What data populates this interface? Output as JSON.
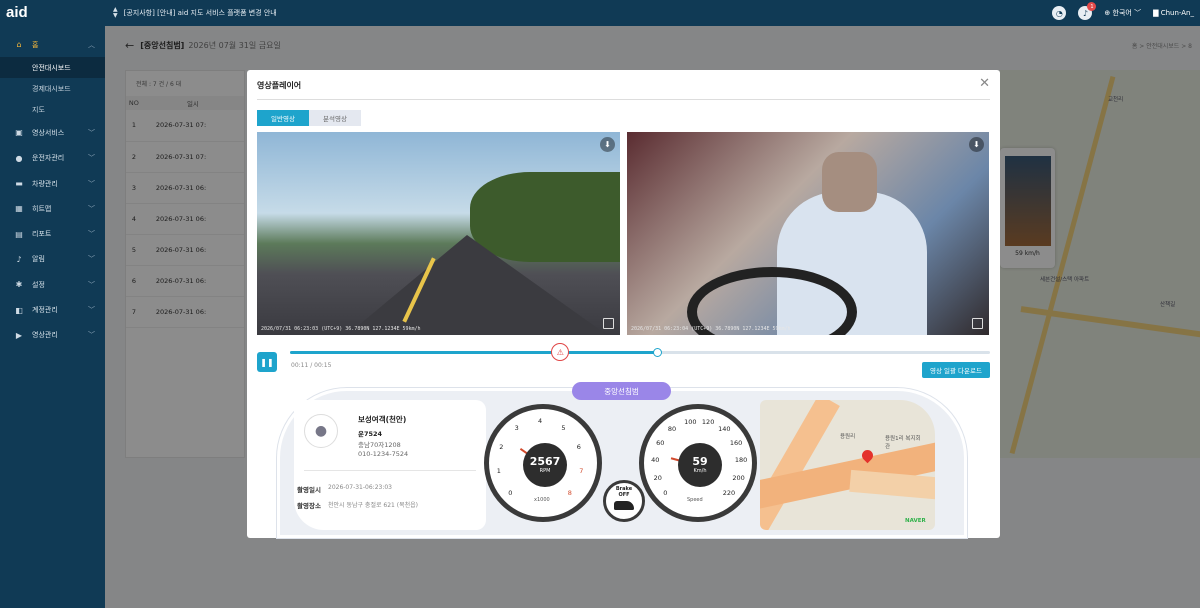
{
  "app": {
    "logo": "aid",
    "notice": "[공지사항] [안내] aid 지도 서비스 플랫폼 변경 안내"
  },
  "topbar": {
    "language": "한국어",
    "user": "Chun-An_",
    "notif_count": "1"
  },
  "sidebar": {
    "items": [
      {
        "label": "홈",
        "icon": "home-icon",
        "active": true
      },
      {
        "label": "영상서비스",
        "icon": "video-icon"
      },
      {
        "label": "운전자관리",
        "icon": "driver-icon"
      },
      {
        "label": "차량관리",
        "icon": "car-icon"
      },
      {
        "label": "히트맵",
        "icon": "heatmap-icon"
      },
      {
        "label": "리포트",
        "icon": "report-icon"
      },
      {
        "label": "알림",
        "icon": "bell-icon"
      },
      {
        "label": "설정",
        "icon": "gear-icon"
      },
      {
        "label": "계정관리",
        "icon": "account-icon"
      },
      {
        "label": "영상관리",
        "icon": "film-icon"
      }
    ],
    "subitems": [
      "안전대시보드",
      "경제대시보드",
      "지도"
    ]
  },
  "page": {
    "title": "[중앙선침범]",
    "date": "2026년 07월 31일 금요일",
    "breadcrumb": "홈 > 안전대시보드 > 8"
  },
  "table": {
    "count": "전체 : 7 건 / 6 대",
    "headers": [
      "NO",
      "일시"
    ],
    "rows": [
      {
        "no": "1",
        "dt": "2026-07-31 07:"
      },
      {
        "no": "2",
        "dt": "2026-07-31 07:"
      },
      {
        "no": "3",
        "dt": "2026-07-31 06:"
      },
      {
        "no": "4",
        "dt": "2026-07-31 06:"
      },
      {
        "no": "5",
        "dt": "2026-07-31 06:"
      },
      {
        "no": "6",
        "dt": "2026-07-31 06:"
      },
      {
        "no": "7",
        "dt": "2026-07-31 06:"
      }
    ]
  },
  "bgmap": {
    "labels": [
      "교천리",
      "세븐건설/스택\n아파트",
      "산책길"
    ],
    "thumb_speed": "59 km/h"
  },
  "modal": {
    "title": "영상플레이어",
    "tabs": [
      "일반영상",
      "분석영상"
    ],
    "front_stamp": "2026/07/31 06:23:03 (UTC+9) 36.7890N 127.1234E 59km/h",
    "cabin_stamp": "2026/07/31 06:23:04 (UTC+9) 36.7890N 127.1234E 59km/h",
    "time": "00:11 / 00:15",
    "progress": 0.72,
    "event_marker": 0.53,
    "download_all": "영상 일괄 다운로드",
    "event_label": "중앙선침범"
  },
  "driver": {
    "name": "보성여객(천안)",
    "vehicle": "운7524",
    "plate": "충남70자1208",
    "phone": "010-1234-7524",
    "shot_time_label": "촬영일시",
    "shot_time": "2026-07-31-06:23:03",
    "shot_place_label": "촬영장소",
    "shot_place": "천안시 동남구 충절로 621 (목천읍)"
  },
  "rpm": {
    "value": "2567",
    "unit": "RPM",
    "scale": "x1000",
    "ticks": [
      "0",
      "1",
      "2",
      "3",
      "4",
      "5",
      "6",
      "7",
      "8"
    ]
  },
  "speed": {
    "value": "59",
    "unit": "Km/h",
    "caption": "Speed",
    "ticks": [
      "0",
      "20",
      "40",
      "60",
      "80",
      "100",
      "120",
      "140",
      "160",
      "180",
      "200",
      "220"
    ]
  },
  "brake": {
    "line1": "Brake",
    "line2": "OFF"
  },
  "minimap": {
    "labels": [
      "용원리",
      "용원1리\n복지회관",
      "NAVER"
    ]
  }
}
